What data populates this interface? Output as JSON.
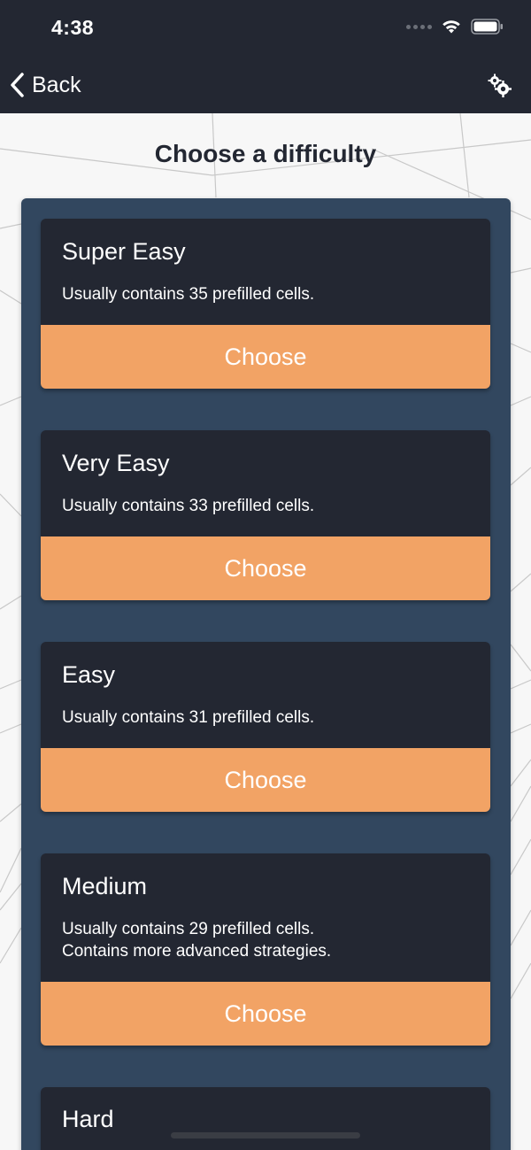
{
  "status_bar": {
    "time": "4:38"
  },
  "nav": {
    "back_label": "Back"
  },
  "page": {
    "title": "Choose a difficulty"
  },
  "difficulties": [
    {
      "title": "Super Easy",
      "description": "Usually contains 35 prefilled cells.",
      "button": "Choose"
    },
    {
      "title": "Very Easy",
      "description": "Usually contains 33 prefilled cells.",
      "button": "Choose"
    },
    {
      "title": "Easy",
      "description": "Usually contains 31 prefilled cells.",
      "button": "Choose"
    },
    {
      "title": "Medium",
      "description": "Usually contains 29 prefilled cells.",
      "description2": "Contains more advanced strategies.",
      "button": "Choose"
    },
    {
      "title": "Hard"
    }
  ],
  "colors": {
    "nav_bg": "#232732",
    "panel_bg": "#32475f",
    "card_bg": "#232732",
    "accent": "#f2a365"
  }
}
